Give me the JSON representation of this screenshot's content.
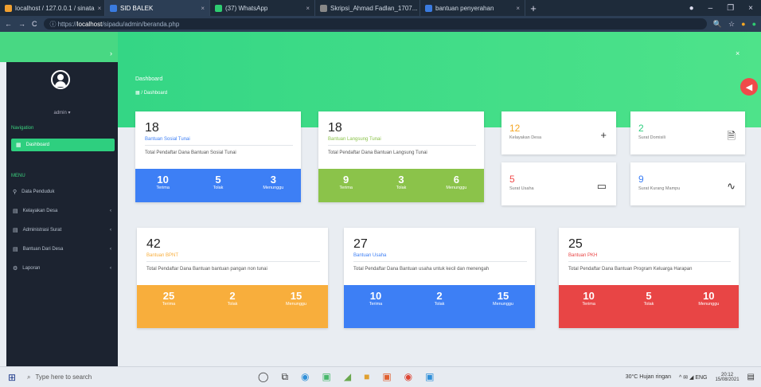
{
  "browser": {
    "tabs": [
      {
        "label": "localhost / 127.0.0.1 / sinata",
        "color": "#f0a030",
        "active": false
      },
      {
        "label": "SID BALEK",
        "color": "#3a7be0",
        "active": true
      },
      {
        "label": "(37) WhatsApp",
        "color": "#2ecc71",
        "active": false
      },
      {
        "label": "Skripsi_Ahmad Fadlan_1707...",
        "color": "#888888",
        "active": false
      },
      {
        "label": "bantuan penyerahan",
        "color": "#3a7be0",
        "active": false
      }
    ],
    "new_tab": "+",
    "window_controls": {
      "profile": "●",
      "minimize": "–",
      "maximize": "❐",
      "close": "×"
    },
    "nav": {
      "back": "←",
      "forward": "→",
      "reload": "C"
    },
    "url_prefix": "ⓘ https://",
    "url_host": "localhost",
    "url_path": "/sipadu/admin/beranda.php",
    "toolbar_icons": [
      "🔍",
      "☆",
      "●",
      "●"
    ]
  },
  "sidebar": {
    "username": "admin ▾",
    "section_main": "Navigation",
    "active_item": {
      "icon": "▦",
      "label": "Dashboard"
    },
    "section_menu": "MENU",
    "items": [
      {
        "icon": "⚲",
        "label": "Data Penduduk",
        "chevron": ""
      },
      {
        "icon": "▤",
        "label": "Kelayakan Desa",
        "chevron": "‹"
      },
      {
        "icon": "▤",
        "label": "Administrasi Surat",
        "chevron": "‹"
      },
      {
        "icon": "▤",
        "label": "Bantuan Dari Desa",
        "chevron": "‹"
      },
      {
        "icon": "⚙",
        "label": "Laporan",
        "chevron": "‹"
      }
    ]
  },
  "header": {
    "title": "Dashboard",
    "breadcrumb_icon": "▦",
    "breadcrumb_sep": "/",
    "breadcrumb": "Dashboard",
    "chevron": "›",
    "close": "×",
    "fab": "◀"
  },
  "cards_top": [
    {
      "num": "18",
      "sub": "Bantuan Sosial Tunai",
      "desc": "Total Pendaftar Dana Bantuan Sosial Tunai",
      "color": "#3d7ff5",
      "stats": [
        {
          "v": "10",
          "l": "Terima"
        },
        {
          "v": "5",
          "l": "Tolak"
        },
        {
          "v": "3",
          "l": "Menunggu"
        }
      ]
    },
    {
      "num": "18",
      "sub": "Bantuan Langsung Tunai",
      "desc": "Total Pendaftar Dana Bantuan Langsung Tunai",
      "color": "#8bc34a",
      "stats": [
        {
          "v": "9",
          "l": "Terima"
        },
        {
          "v": "3",
          "l": "Tolak"
        },
        {
          "v": "6",
          "l": "Menunggu"
        }
      ]
    }
  ],
  "minis": [
    {
      "num": "12",
      "label": "Kelayakan Desa",
      "icon": "+",
      "numcolor": "#f5a623"
    },
    {
      "num": "2",
      "label": "Surat Domisili",
      "icon": "🗎",
      "numcolor": "#2ecf7f"
    },
    {
      "num": "5",
      "label": "Surat Usaha",
      "icon": "▭",
      "numcolor": "#f04a4a"
    },
    {
      "num": "9",
      "label": "Surat Kurang Mampu",
      "icon": "∿",
      "numcolor": "#3d7ff5"
    }
  ],
  "cards_bottom": [
    {
      "num": "42",
      "sub": "Bantuan BPNT",
      "desc": "Total Pendaftar Dana Bantuan bantuan pangan non tunai",
      "color": "#f8ae3c",
      "stats": [
        {
          "v": "25",
          "l": "Terima"
        },
        {
          "v": "2",
          "l": "Tolak"
        },
        {
          "v": "15",
          "l": "Menunggu"
        }
      ]
    },
    {
      "num": "27",
      "sub": "Bantuan Usaha",
      "desc": "Total Pendaftar Dana Bantuan usaha untuk kecil dan menengah",
      "color": "#3d7ff5",
      "stats": [
        {
          "v": "10",
          "l": "Terima"
        },
        {
          "v": "2",
          "l": "Tolak"
        },
        {
          "v": "15",
          "l": "Menunggu"
        }
      ]
    },
    {
      "num": "25",
      "sub": "Bantuan PKH",
      "desc": "Total Pendaftar Dana Bantuan Program Keluarga Harapan",
      "color": "#e84545",
      "stats": [
        {
          "v": "10",
          "l": "Terima"
        },
        {
          "v": "5",
          "l": "Tolak"
        },
        {
          "v": "10",
          "l": "Menunggu"
        }
      ]
    }
  ],
  "taskbar": {
    "start_icon": "⊞",
    "search_icon": "⌕",
    "search_placeholder": "Type here to search",
    "apps": [
      {
        "glyph": "◯",
        "color": "#333333"
      },
      {
        "glyph": "⧉",
        "color": "#333333"
      },
      {
        "glyph": "◉",
        "color": "#2f8fd8"
      },
      {
        "glyph": "▣",
        "color": "#48b86b"
      },
      {
        "glyph": "◢",
        "color": "#6aa84f"
      },
      {
        "glyph": "■",
        "color": "#e0a030"
      },
      {
        "glyph": "▣",
        "color": "#e06030"
      },
      {
        "glyph": "◉",
        "color": "#dd4433"
      },
      {
        "glyph": "▣",
        "color": "#2f8fd8"
      }
    ],
    "weather": "30°C Hujan ringan",
    "tray_icons": "^ ✉ ◢ ENG",
    "time": "20:12",
    "date": "15/08/2021",
    "notification_icon": "▤"
  }
}
